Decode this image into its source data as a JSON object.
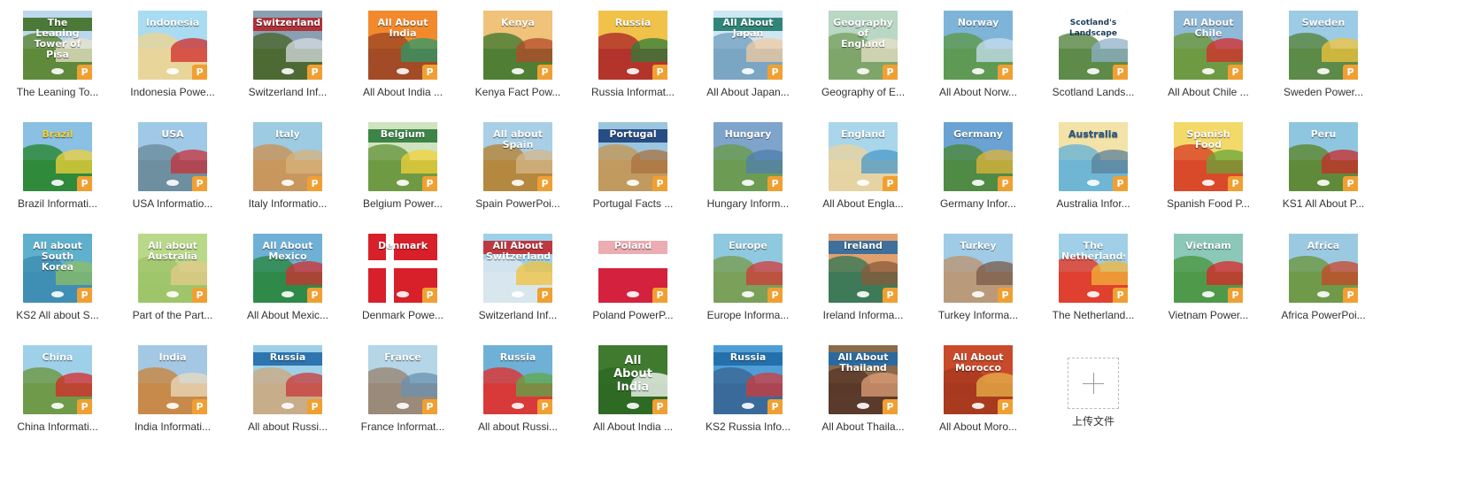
{
  "files": [
    {
      "label": "The Leaning To...",
      "thumb_text": "The Leaning\nTower of Pisa",
      "sky": "#bcd8ee",
      "ground": "#5f8a3b",
      "banner": "#3e6f24",
      "accent": "#e9e3c9"
    },
    {
      "label": "Indonesia Powe...",
      "thumb_text": "Indonesia",
      "sky": "#a9dcf2",
      "ground": "#e8d59a",
      "banner": "",
      "accent": "#d12a2a"
    },
    {
      "label": "Switzerland Inf...",
      "thumb_text": "Switzerland",
      "sky": "#8aa0b2",
      "ground": "#4e6a34",
      "banner": "#b3262c",
      "accent": "#d7dde2"
    },
    {
      "label": "All About India ...",
      "thumb_text": "All About\nIndia",
      "sky": "#f28a2d",
      "ground": "#a34b26",
      "banner": "",
      "accent": "#2a9a6a"
    },
    {
      "label": "Kenya Fact Pow...",
      "thumb_text": "Kenya",
      "sky": "#f1c27a",
      "ground": "#4f7f35",
      "banner": "",
      "accent": "#b34a2a"
    },
    {
      "label": "Russia Informat...",
      "thumb_text": "Russia",
      "sky": "#f0c24a",
      "ground": "#b2342b",
      "banner": "",
      "accent": "#2f7d3a"
    },
    {
      "label": "All About Japan...",
      "thumb_text": "All About Japan",
      "sky": "#cfe6f3",
      "ground": "#7aa6c4",
      "banner": "#1f7a6a",
      "accent": "#f2c9a0"
    },
    {
      "label": "Geography of E...",
      "thumb_text": "Geography of\nEngland",
      "sky": "#b9d7c4",
      "ground": "#7ea66a",
      "banner": "",
      "accent": "#e8e0c8"
    },
    {
      "label": "All About Norw...",
      "thumb_text": "Norway",
      "sky": "#7fb4d9",
      "ground": "#5f9a55",
      "banner": "",
      "accent": "#c8e0f0"
    },
    {
      "label": "Scotland Lands...",
      "thumb_text": "Scotland's Landscape",
      "sky": "#ffffff",
      "ground": "#5e8a4a",
      "banner": "",
      "accent": "#8fb0c8",
      "dark_text": true
    },
    {
      "label": "All About Chile ...",
      "thumb_text": "All About Chile",
      "sky": "#8fb9d8",
      "ground": "#6f9a44",
      "banner": "",
      "accent": "#d52b2b"
    },
    {
      "label": "Sweden Power...",
      "thumb_text": "Sweden",
      "sky": "#9ccbe6",
      "ground": "#5c8a48",
      "banner": "",
      "accent": "#f2c43a"
    },
    {
      "label": "Brazil Informati...",
      "thumb_text": "Brazil",
      "sky": "#89c0e3",
      "ground": "#2f8a3b",
      "banner": "",
      "accent": "#f2d23a",
      "title_color": "#f2d23a"
    },
    {
      "label": "USA Informatio...",
      "thumb_text": "USA",
      "sky": "#9fc9e6",
      "ground": "#6d8fa0",
      "banner": "",
      "accent": "#c7303a"
    },
    {
      "label": "Italy Informatio...",
      "thumb_text": "Italy",
      "sky": "#9ccbe2",
      "ground": "#c8975e",
      "banner": "",
      "accent": "#d8b27a"
    },
    {
      "label": "Belgium Power...",
      "thumb_text": "Belgium",
      "sky": "#cfe3c0",
      "ground": "#6f9a44",
      "banner": "#2c7a3a",
      "accent": "#f2d23a"
    },
    {
      "label": "Spain PowerPoi...",
      "thumb_text": "All about Spain",
      "sky": "#a9cfe6",
      "ground": "#b5883f",
      "banner": "",
      "accent": "#d6b78a"
    },
    {
      "label": "Portugal Facts ...",
      "thumb_text": "Portugal",
      "sky": "#9cc5df",
      "ground": "#c19a5f",
      "banner": "#1c3f7a",
      "accent": "#a8723f"
    },
    {
      "label": "Hungary Inform...",
      "thumb_text": "Hungary",
      "sky": "#7ea4cc",
      "ground": "#6c9c54",
      "banner": "",
      "accent": "#4f7fae"
    },
    {
      "label": "All About Engla...",
      "thumb_text": "England",
      "sky": "#a9d6ea",
      "ground": "#e5d3a4",
      "banner": "",
      "accent": "#4a9ac9"
    },
    {
      "label": "Germany Infor...",
      "thumb_text": "Germany",
      "sky": "#6aa3d3",
      "ground": "#4f8b44",
      "banner": "",
      "accent": "#e0b43a"
    },
    {
      "label": "Australia Infor...",
      "thumb_text": "Australia",
      "sky": "#f3e3a8",
      "ground": "#6fb6d4",
      "banner": "",
      "accent": "#5b7f9a",
      "title_color": "#2a5a8a"
    },
    {
      "label": "Spanish Food P...",
      "thumb_text": "Spanish Food",
      "sky": "#f3d96a",
      "ground": "#d94a2a",
      "banner": "",
      "accent": "#6aa63a"
    },
    {
      "label": "KS1 All About P...",
      "thumb_text": "Peru",
      "sky": "#8fc6df",
      "ground": "#5f8a3a",
      "banner": "",
      "accent": "#c72a2a"
    },
    {
      "label": "KS2 All about S...",
      "thumb_text": "All about\nSouth Korea",
      "sky": "#5fb0cc",
      "ground": "#3f8fb4",
      "banner": "",
      "accent": "#8fbf64"
    },
    {
      "label": "Part of the Part...",
      "thumb_text": "All about\nAustralia",
      "sky": "#b9d88a",
      "ground": "#9fc56a",
      "banner": "",
      "accent": "#e6c98a"
    },
    {
      "label": "All About Mexic...",
      "thumb_text": "All About Mexico",
      "sky": "#6fb1d6",
      "ground": "#2f8a4a",
      "banner": "",
      "accent": "#d22f2f"
    },
    {
      "label": "Denmark Powe...",
      "thumb_text": "Denmark",
      "sky": "#d8202a",
      "ground": "#d8202a",
      "banner": "",
      "accent": "#ffffff",
      "flag": "denmark"
    },
    {
      "label": "Switzerland Inf...",
      "thumb_text": "All About Switzerland",
      "sky": "#9ed0ea",
      "ground": "#d8e6ee",
      "banner": "#c1272d",
      "accent": "#f0c23a"
    },
    {
      "label": "Poland PowerP...",
      "thumb_text": "Poland",
      "sky": "#ffffff",
      "ground": "#d4213d",
      "banner": "#e9a3aa",
      "accent": "#d4213d",
      "flag": "poland"
    },
    {
      "label": "Europe Informa...",
      "thumb_text": "Europe",
      "sky": "#8fc9e0",
      "ground": "#7aa05a",
      "banner": "",
      "accent": "#d23a3a"
    },
    {
      "label": "Ireland Informa...",
      "thumb_text": "Ireland",
      "sky": "#e3a06f",
      "ground": "#3f7a58",
      "banner": "#2b6aa0",
      "accent": "#8a5a3a"
    },
    {
      "label": "Turkey Informa...",
      "thumb_text": "Turkey",
      "sky": "#9fcbe6",
      "ground": "#b99a7a",
      "banner": "",
      "accent": "#7a5a4a"
    },
    {
      "label": "The Netherland...",
      "thumb_text": "The Netherlands",
      "sky": "#9fd0e8",
      "ground": "#e0402f",
      "banner": "",
      "accent": "#f2b43a"
    },
    {
      "label": "Vietnam Power...",
      "thumb_text": "Vietnam",
      "sky": "#8cc8b8",
      "ground": "#4f9a4a",
      "banner": "",
      "accent": "#d9262a"
    },
    {
      "label": "Africa PowerPoi...",
      "thumb_text": "Africa",
      "sky": "#9cc9e2",
      "ground": "#6f9a4a",
      "banner": "",
      "accent": "#c8452a"
    },
    {
      "label": "China Informati...",
      "thumb_text": "China",
      "sky": "#9fd0ea",
      "ground": "#6f9a4a",
      "banner": "",
      "accent": "#d62a2a"
    },
    {
      "label": "India Informati...",
      "thumb_text": "India",
      "sky": "#a4c8e4",
      "ground": "#c78a4a",
      "banner": "",
      "accent": "#eadbc0"
    },
    {
      "label": "All about Russi...",
      "thumb_text": "Russia",
      "sky": "#9fd0ea",
      "ground": "#c8ad8a",
      "banner": "#1f6aa8",
      "accent": "#c83a3a"
    },
    {
      "label": "France Informat...",
      "thumb_text": "France",
      "sky": "#b4d6e6",
      "ground": "#9a8a7a",
      "banner": "",
      "accent": "#6a90b0"
    },
    {
      "label": "All about Russi...",
      "thumb_text": "Russia",
      "sky": "#6fb1d6",
      "ground": "#d83a3a",
      "banner": "",
      "accent": "#5fa84a"
    },
    {
      "label": "All About India ...",
      "thumb_text": "All\nAbout\nIndia",
      "sky": "#3f7a2f",
      "ground": "#2f6a25",
      "banner": "",
      "accent": "#ffffff",
      "big_title": true
    },
    {
      "label": "KS2 Russia Info...",
      "thumb_text": "Russia",
      "sky": "#4f9fd6",
      "ground": "#3a6a9a",
      "banner": "#1f6aa8",
      "accent": "#d23a3a"
    },
    {
      "label": "All About Thaila...",
      "thumb_text": "All About Thailand",
      "sky": "#8a6a4a",
      "ground": "#5a3a2a",
      "banner": "#1f6aa8",
      "accent": "#e0a07a"
    },
    {
      "label": "All About Moro...",
      "thumb_text": "All About Morocco",
      "sky": "#c84a2a",
      "ground": "#a83a1f",
      "banner": "",
      "accent": "#e8b44a"
    }
  ],
  "upload": {
    "label": "上传文件"
  },
  "badge_glyph": "P",
  "icons": {
    "file_badge": "powerpoint-icon",
    "upload": "plus-icon"
  }
}
